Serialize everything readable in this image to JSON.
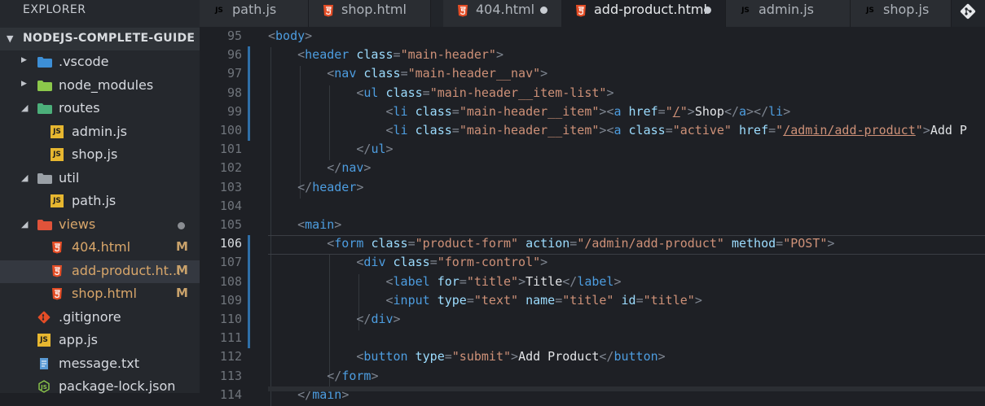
{
  "sidebar": {
    "title": "EXPLORER",
    "project": "NODEJS-COMPLETE-GUIDE",
    "items": [
      {
        "label": ".vscode",
        "icon": "vscode-folder-icon",
        "kind": "folder",
        "badge": ""
      },
      {
        "label": "node_modules",
        "icon": "node-folder-icon",
        "kind": "folder",
        "badge": ""
      },
      {
        "label": "routes",
        "icon": "routes-folder-icon",
        "kind": "folder-open",
        "badge": ""
      },
      {
        "label": "admin.js",
        "icon": "js-file-icon",
        "kind": "file",
        "badge": ""
      },
      {
        "label": "shop.js",
        "icon": "js-file-icon",
        "kind": "file",
        "badge": ""
      },
      {
        "label": "util",
        "icon": "folder-icon",
        "kind": "folder-open",
        "badge": ""
      },
      {
        "label": "path.js",
        "icon": "js-file-icon",
        "kind": "file",
        "badge": ""
      },
      {
        "label": "views",
        "icon": "views-folder-icon",
        "kind": "folder-open",
        "badge": ""
      },
      {
        "label": "404.html",
        "icon": "html5-file-icon",
        "kind": "file",
        "badge": "M"
      },
      {
        "label": "add-product.ht...",
        "icon": "html5-file-icon",
        "kind": "file",
        "badge": "M"
      },
      {
        "label": "shop.html",
        "icon": "html5-file-icon",
        "kind": "file",
        "badge": "M"
      },
      {
        "label": ".gitignore",
        "icon": "git-file-icon",
        "kind": "file",
        "badge": ""
      },
      {
        "label": "app.js",
        "icon": "js-file-icon",
        "kind": "file",
        "badge": ""
      },
      {
        "label": "message.txt",
        "icon": "text-file-icon",
        "kind": "file",
        "badge": ""
      },
      {
        "label": "package-lock.json",
        "icon": "node-file-icon",
        "kind": "file",
        "badge": ""
      }
    ]
  },
  "tabs": [
    {
      "label": "path.js",
      "icon": "js-file-icon",
      "dirty": false,
      "active": false
    },
    {
      "label": "shop.html",
      "icon": "html5-file-icon",
      "dirty": false,
      "active": false
    },
    {
      "label": "404.html",
      "icon": "html5-file-icon",
      "dirty": true,
      "active": false
    },
    {
      "label": "add-product.html",
      "icon": "html5-file-icon",
      "dirty": true,
      "active": true
    },
    {
      "label": "admin.js",
      "icon": "js-file-icon",
      "dirty": false,
      "active": false
    },
    {
      "label": "shop.js",
      "icon": "js-file-icon",
      "dirty": false,
      "active": false
    }
  ],
  "editor": {
    "current_line": 106,
    "lines": [
      {
        "n": 95,
        "tokens": [
          [
            "br",
            "<"
          ],
          [
            "tag",
            "body"
          ],
          [
            "br",
            ">"
          ]
        ]
      },
      {
        "n": 96,
        "tokens": [
          [
            "txt",
            "    "
          ],
          [
            "br",
            "<"
          ],
          [
            "tag",
            "header"
          ],
          [
            "txt",
            " "
          ],
          [
            "attr",
            "class"
          ],
          [
            "br",
            "="
          ],
          [
            "str",
            "\"main-header\""
          ],
          [
            "br",
            ">"
          ]
        ]
      },
      {
        "n": 97,
        "tokens": [
          [
            "txt",
            "        "
          ],
          [
            "br",
            "<"
          ],
          [
            "tag",
            "nav"
          ],
          [
            "txt",
            " "
          ],
          [
            "attr",
            "class"
          ],
          [
            "br",
            "="
          ],
          [
            "str",
            "\"main-header__nav\""
          ],
          [
            "br",
            ">"
          ]
        ]
      },
      {
        "n": 98,
        "tokens": [
          [
            "txt",
            "            "
          ],
          [
            "br",
            "<"
          ],
          [
            "tag",
            "ul"
          ],
          [
            "txt",
            " "
          ],
          [
            "attr",
            "class"
          ],
          [
            "br",
            "="
          ],
          [
            "str",
            "\"main-header__item-list\""
          ],
          [
            "br",
            ">"
          ]
        ]
      },
      {
        "n": 99,
        "tokens": [
          [
            "txt",
            "                "
          ],
          [
            "br",
            "<"
          ],
          [
            "tag",
            "li"
          ],
          [
            "txt",
            " "
          ],
          [
            "attr",
            "class"
          ],
          [
            "br",
            "="
          ],
          [
            "str",
            "\"main-header__item\""
          ],
          [
            "br",
            ">"
          ],
          [
            "br",
            "<"
          ],
          [
            "tag",
            "a"
          ],
          [
            "txt",
            " "
          ],
          [
            "attr",
            "href"
          ],
          [
            "br",
            "="
          ],
          [
            "str",
            "\""
          ],
          [
            "strul",
            "/"
          ],
          [
            "str",
            "\""
          ],
          [
            "br",
            ">"
          ],
          [
            "txt",
            "Shop"
          ],
          [
            "br",
            "</"
          ],
          [
            "tag",
            "a"
          ],
          [
            "br",
            "></"
          ],
          [
            "tag",
            "li"
          ],
          [
            "br",
            ">"
          ]
        ]
      },
      {
        "n": 100,
        "tokens": [
          [
            "txt",
            "                "
          ],
          [
            "br",
            "<"
          ],
          [
            "tag",
            "li"
          ],
          [
            "txt",
            " "
          ],
          [
            "attr",
            "class"
          ],
          [
            "br",
            "="
          ],
          [
            "str",
            "\"main-header__item\""
          ],
          [
            "br",
            ">"
          ],
          [
            "br",
            "<"
          ],
          [
            "tag",
            "a"
          ],
          [
            "txt",
            " "
          ],
          [
            "attr",
            "class"
          ],
          [
            "br",
            "="
          ],
          [
            "str",
            "\"active\""
          ],
          [
            "txt",
            " "
          ],
          [
            "attr",
            "href"
          ],
          [
            "br",
            "="
          ],
          [
            "str",
            "\""
          ],
          [
            "strul",
            "/admin/add-product"
          ],
          [
            "str",
            "\""
          ],
          [
            "br",
            ">"
          ],
          [
            "txt",
            "Add P"
          ]
        ]
      },
      {
        "n": 101,
        "tokens": [
          [
            "txt",
            "            "
          ],
          [
            "br",
            "</"
          ],
          [
            "tag",
            "ul"
          ],
          [
            "br",
            ">"
          ]
        ]
      },
      {
        "n": 102,
        "tokens": [
          [
            "txt",
            "        "
          ],
          [
            "br",
            "</"
          ],
          [
            "tag",
            "nav"
          ],
          [
            "br",
            ">"
          ]
        ]
      },
      {
        "n": 103,
        "tokens": [
          [
            "txt",
            "    "
          ],
          [
            "br",
            "</"
          ],
          [
            "tag",
            "header"
          ],
          [
            "br",
            ">"
          ]
        ]
      },
      {
        "n": 104,
        "tokens": []
      },
      {
        "n": 105,
        "tokens": [
          [
            "txt",
            "    "
          ],
          [
            "br",
            "<"
          ],
          [
            "tag",
            "main"
          ],
          [
            "br",
            ">"
          ]
        ]
      },
      {
        "n": 106,
        "tokens": [
          [
            "txt",
            "        "
          ],
          [
            "br",
            "<"
          ],
          [
            "tag",
            "form"
          ],
          [
            "txt",
            " "
          ],
          [
            "attr",
            "class"
          ],
          [
            "br",
            "="
          ],
          [
            "str",
            "\"product-form\""
          ],
          [
            "txt",
            " "
          ],
          [
            "attr",
            "action"
          ],
          [
            "br",
            "="
          ],
          [
            "str",
            "\"/admin/add-product\""
          ],
          [
            "txt",
            " "
          ],
          [
            "attr",
            "method"
          ],
          [
            "br",
            "="
          ],
          [
            "str",
            "\"POST\""
          ],
          [
            "br",
            ">"
          ]
        ]
      },
      {
        "n": 107,
        "tokens": [
          [
            "txt",
            "            "
          ],
          [
            "br",
            "<"
          ],
          [
            "tag",
            "div"
          ],
          [
            "txt",
            " "
          ],
          [
            "attr",
            "class"
          ],
          [
            "br",
            "="
          ],
          [
            "str",
            "\"form-control\""
          ],
          [
            "br",
            ">"
          ]
        ]
      },
      {
        "n": 108,
        "tokens": [
          [
            "txt",
            "                "
          ],
          [
            "br",
            "<"
          ],
          [
            "tag",
            "label"
          ],
          [
            "txt",
            " "
          ],
          [
            "attr",
            "for"
          ],
          [
            "br",
            "="
          ],
          [
            "str",
            "\"title\""
          ],
          [
            "br",
            ">"
          ],
          [
            "txt",
            "Title"
          ],
          [
            "br",
            "</"
          ],
          [
            "tag",
            "label"
          ],
          [
            "br",
            ">"
          ]
        ]
      },
      {
        "n": 109,
        "tokens": [
          [
            "txt",
            "                "
          ],
          [
            "br",
            "<"
          ],
          [
            "tag",
            "input"
          ],
          [
            "txt",
            " "
          ],
          [
            "attr",
            "type"
          ],
          [
            "br",
            "="
          ],
          [
            "str",
            "\"text\""
          ],
          [
            "txt",
            " "
          ],
          [
            "attr",
            "name"
          ],
          [
            "br",
            "="
          ],
          [
            "str",
            "\"title\""
          ],
          [
            "txt",
            " "
          ],
          [
            "attr",
            "id"
          ],
          [
            "br",
            "="
          ],
          [
            "str",
            "\"title\""
          ],
          [
            "br",
            ">"
          ]
        ]
      },
      {
        "n": 110,
        "tokens": [
          [
            "txt",
            "            "
          ],
          [
            "br",
            "</"
          ],
          [
            "tag",
            "div"
          ],
          [
            "br",
            ">"
          ]
        ]
      },
      {
        "n": 111,
        "tokens": []
      },
      {
        "n": 112,
        "tokens": [
          [
            "txt",
            "            "
          ],
          [
            "br",
            "<"
          ],
          [
            "tag",
            "button"
          ],
          [
            "txt",
            " "
          ],
          [
            "attr",
            "type"
          ],
          [
            "br",
            "="
          ],
          [
            "str",
            "\"submit\""
          ],
          [
            "br",
            ">"
          ],
          [
            "txt",
            "Add Product"
          ],
          [
            "br",
            "</"
          ],
          [
            "tag",
            "button"
          ],
          [
            "br",
            ">"
          ]
        ]
      },
      {
        "n": 113,
        "tokens": [
          [
            "txt",
            "        "
          ],
          [
            "br",
            "</"
          ],
          [
            "tag",
            "form"
          ],
          [
            "br",
            ">"
          ]
        ]
      },
      {
        "n": 114,
        "tokens": [
          [
            "txt",
            "    "
          ],
          [
            "br",
            "</"
          ],
          [
            "tag",
            "main"
          ],
          [
            "br",
            ">"
          ]
        ]
      }
    ]
  },
  "colors": {
    "tag": "#4d9de0",
    "attr": "#9cdcfe",
    "string": "#ce9178",
    "modified_badge": "#c9a26b",
    "modified_bar": "#2f6fa8"
  }
}
